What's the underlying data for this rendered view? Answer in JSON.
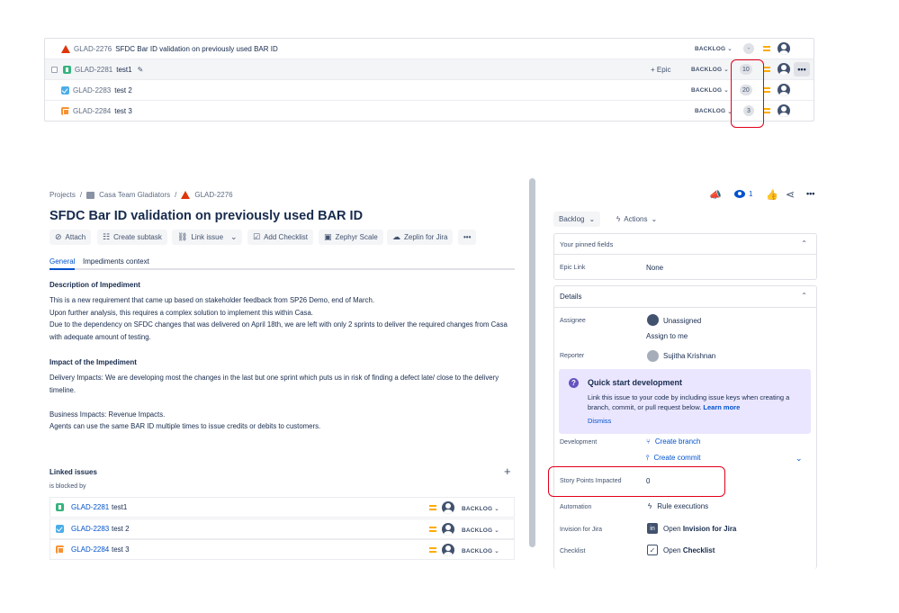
{
  "top_list": {
    "rows": [
      {
        "key": "GLAD-2276",
        "summary": "SFDC Bar ID validation on previously used BAR ID",
        "status": "BACKLOG",
        "points": "-"
      },
      {
        "key": "GLAD-2281",
        "summary": "test1",
        "status": "BACKLOG",
        "points": "10",
        "epic_button": "+ Epic"
      },
      {
        "key": "GLAD-2283",
        "summary": "test 2",
        "status": "BACKLOG",
        "points": "20"
      },
      {
        "key": "GLAD-2284",
        "summary": "test 3",
        "status": "BACKLOG",
        "points": "3"
      }
    ]
  },
  "breadcrumb": {
    "projects": "Projects",
    "project": "Casa Team Gladiators",
    "issue": "GLAD-2276",
    "sep": "/"
  },
  "issue": {
    "title": "SFDC Bar ID validation on previously used BAR ID"
  },
  "toolbar": {
    "attach": "Attach",
    "subtask": "Create subtask",
    "link": "Link issue",
    "checklist": "Add Checklist",
    "zephyr": "Zephyr Scale",
    "zeplin": "Zeplin for Jira",
    "more": "•••"
  },
  "tabs": {
    "general": "General",
    "impediments": "Impediments context"
  },
  "description": {
    "heading": "Description of Impediment",
    "lines": [
      "This is a new requirement that came up based on stakeholder feedback from SP26 Demo, end of March.",
      "Upon further analysis, this requires a complex solution to implement this within Casa.",
      "Due to the dependency on SFDC changes that was delivered on April 18th, we are left with only 2 sprints to deliver the required changes from Casa",
      "with adequate amount of testing."
    ]
  },
  "impact": {
    "heading": "Impact of the Impediment",
    "delivery": [
      "Delivery Impacts: We are developing most the changes in the last but one sprint which puts us in risk of finding a defect late/ close to the delivery",
      "timeline."
    ],
    "business": [
      "Business Impacts: Revenue Impacts.",
      "Agents can use the same BAR ID multiple times to issue credits or debits to customers."
    ]
  },
  "linked": {
    "heading": "Linked issues",
    "relation": "is blocked by",
    "add": "+",
    "items": [
      {
        "key": "GLAD-2281",
        "summary": "test1",
        "status": "BACKLOG"
      },
      {
        "key": "GLAD-2283",
        "summary": "test 2",
        "status": "BACKLOG"
      },
      {
        "key": "GLAD-2284",
        "summary": "test 3",
        "status": "BACKLOG"
      }
    ]
  },
  "header_actions": {
    "watch_count": "1"
  },
  "status_bar": {
    "status": "Backlog",
    "actions": "Actions"
  },
  "pinned": {
    "heading": "Your pinned fields",
    "epic_label": "Epic Link",
    "epic_value": "None"
  },
  "details": {
    "heading": "Details",
    "assignee_label": "Assignee",
    "assignee_value": "Unassigned",
    "assign_to_me": "Assign to me",
    "reporter_label": "Reporter",
    "reporter_value": "Sujitha Krishnan",
    "qsd_title": "Quick start development",
    "qsd_text_1": "Link this issue to your code by including issue keys when creating a",
    "qsd_text_2": "branch, commit, or pull request below.",
    "qsd_learn": "Learn more",
    "qsd_dismiss": "Dismiss",
    "development_label": "Development",
    "create_branch": "Create branch",
    "create_commit": "Create commit",
    "story_points_label": "Story Points Impacted",
    "story_points_value": "0",
    "automation_label": "Automation",
    "automation_value": "Rule executions",
    "invision_label": "Invision for Jira",
    "invision_prefix": "Open",
    "invision_bold": "Invision for Jira",
    "checklist_label": "Checklist",
    "checklist_prefix": "Open",
    "checklist_bold": "Checklist"
  },
  "colors": {
    "accent": "#0052cc",
    "highlight": "#e2001a",
    "priority": "#ffab00"
  }
}
